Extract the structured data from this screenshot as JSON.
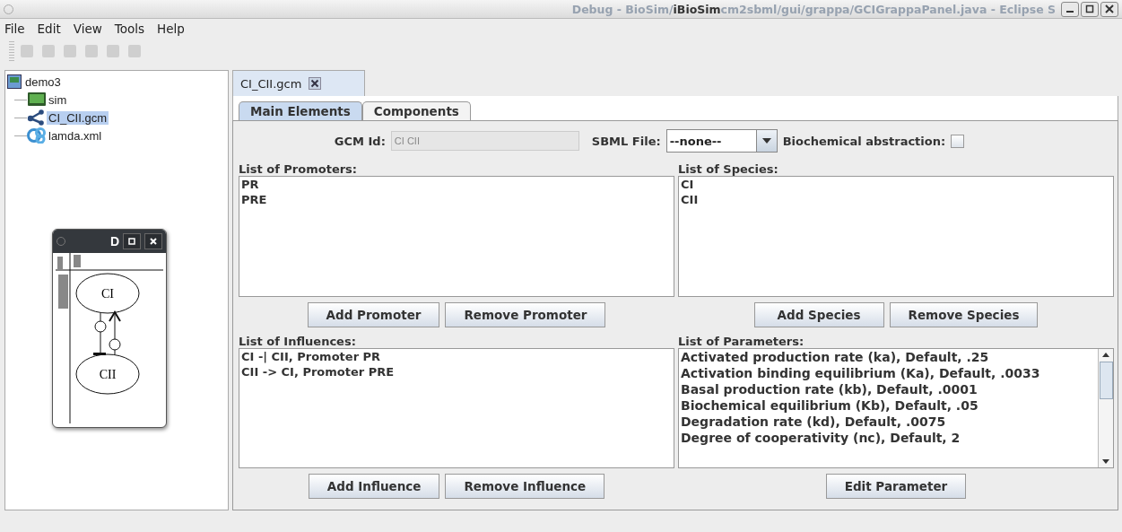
{
  "window": {
    "title": "iBioSim",
    "background_title_left": "Debug - BioSim/",
    "background_title_right": "cm2sbml/gui/grappa/GCIGrappaPanel.java - Eclipse S"
  },
  "menu": [
    "File",
    "Edit",
    "View",
    "Tools",
    "Help"
  ],
  "toolbar": [
    {
      "disabled": true
    },
    {
      "disabled": true
    },
    {
      "disabled": true
    },
    {
      "disabled": true
    },
    {
      "disabled": true
    },
    {
      "disabled": true
    }
  ],
  "tree": {
    "label": "demo3",
    "kind": "project",
    "selected": false,
    "children": [
      {
        "label": "sim",
        "kind": "analysis",
        "selected": false
      },
      {
        "label": "CI_CII.gcm",
        "kind": "gcm",
        "selected": true
      },
      {
        "label": "lamda.xml",
        "kind": "sbml",
        "selected": false
      }
    ]
  },
  "mini_window": {
    "title": "D",
    "nodes": [
      "CI",
      "CII"
    ]
  },
  "file_tabs": [
    {
      "label": "CI_CII.gcm",
      "selected": true
    }
  ],
  "tabs": [
    {
      "label": "Main Elements",
      "selected": true
    },
    {
      "label": "Components",
      "selected": false
    }
  ],
  "gcm_id": {
    "label": "GCM Id:",
    "value": "CI CII"
  },
  "sbml_file": {
    "label": "SBML File:",
    "value": "--none--"
  },
  "biochemical": {
    "label": "Biochemical abstraction:",
    "checked": false
  },
  "lists": [
    {
      "label": "List of Promoters:",
      "items": [
        "PR",
        "PRE"
      ],
      "buttons": [
        "Add Promoter",
        "Remove Promoter"
      ],
      "scroll": false
    },
    {
      "label": "List of Species:",
      "items": [
        "CI",
        "CII"
      ],
      "buttons": [
        "Add Species",
        "Remove Species"
      ],
      "scroll": false
    },
    {
      "label": "List of Influences:",
      "items": [
        "CI -| CII, Promoter PR",
        "CII -> CI, Promoter PRE"
      ],
      "buttons": [
        "Add Influence",
        "Remove Influence"
      ],
      "scroll": false
    },
    {
      "label": "List of Parameters:",
      "items": [
        "Activated production rate (ka), Default, .25",
        "Activation binding equilibrium (Ka), Default, .0033",
        "Basal production rate (kb), Default, .0001",
        "Biochemical equilibrium (Kb), Default, .05",
        "Degradation rate (kd), Default, .0075",
        "Degree of cooperativity (nc), Default, 2"
      ],
      "buttons": [
        "Edit Parameter"
      ],
      "scroll": true
    }
  ]
}
